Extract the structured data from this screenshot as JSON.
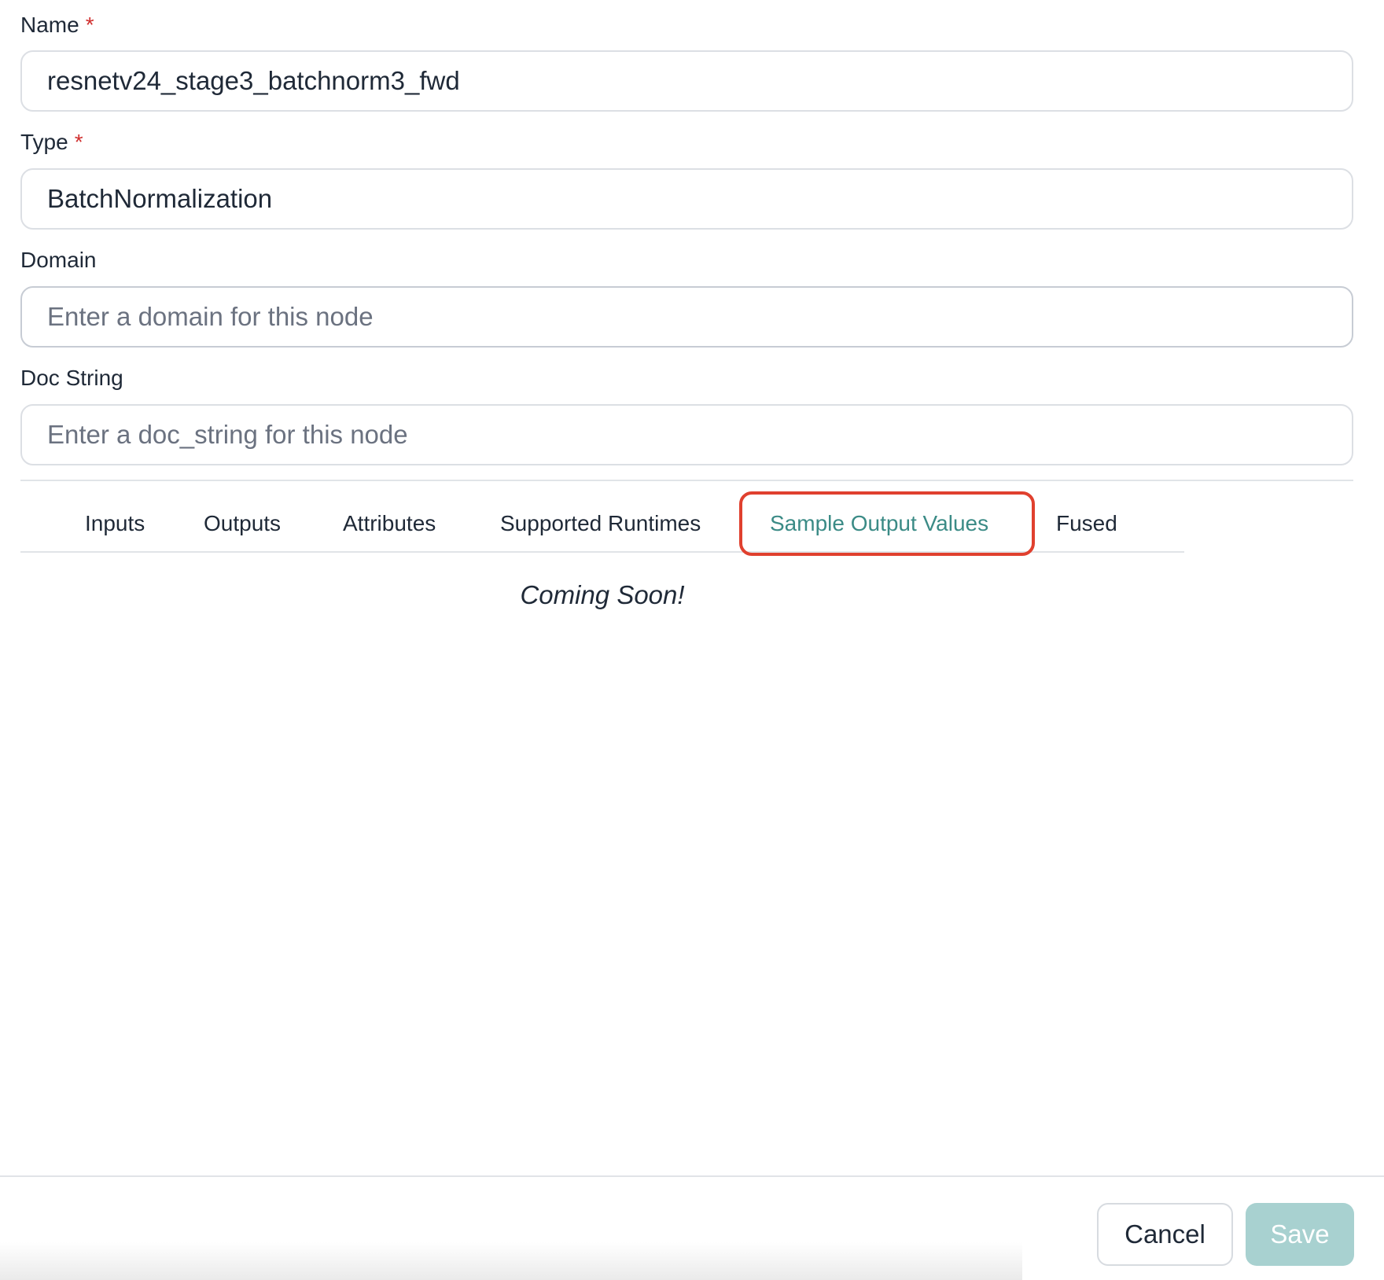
{
  "form": {
    "name": {
      "label": "Name",
      "required_mark": "*",
      "value": "resnetv24_stage3_batchnorm3_fwd"
    },
    "type": {
      "label": "Type",
      "required_mark": "*",
      "value": "BatchNormalization"
    },
    "domain": {
      "label": "Domain",
      "placeholder": "Enter a domain for this node"
    },
    "doc_string": {
      "label": "Doc String",
      "placeholder": "Enter a doc_string for this node"
    }
  },
  "tabs": [
    {
      "label": "Inputs",
      "active": false
    },
    {
      "label": "Outputs",
      "active": false
    },
    {
      "label": "Attributes",
      "active": false
    },
    {
      "label": "Supported Runtimes",
      "active": false
    },
    {
      "label": "Sample Output Values",
      "active": true
    },
    {
      "label": "Fused",
      "active": false
    }
  ],
  "tab_content": {
    "message": "Coming Soon!"
  },
  "footer": {
    "cancel_label": "Cancel",
    "save_label": "Save"
  },
  "colors": {
    "accent": "#3b8b86",
    "required": "#d0302f",
    "highlight": "#e0402e",
    "save_disabled": "#a8d1d0"
  }
}
